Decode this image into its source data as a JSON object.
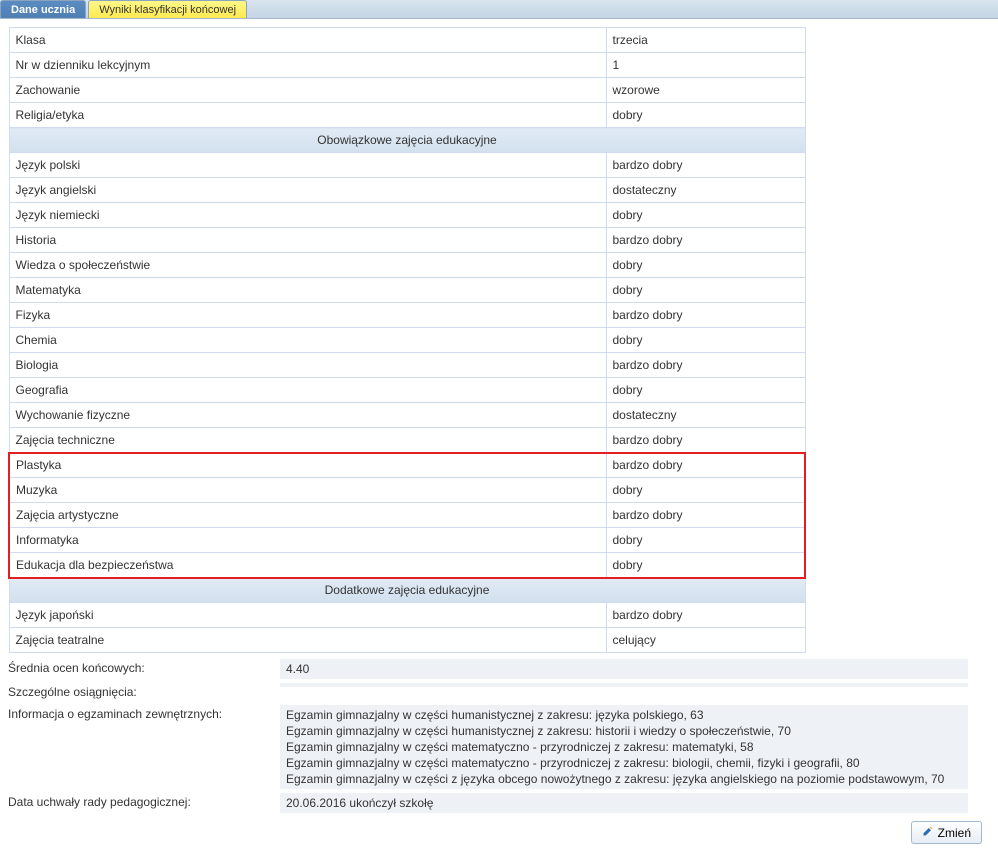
{
  "tabs": [
    {
      "label": "Dane ucznia",
      "active": true
    },
    {
      "label": "Wyniki klasyfikacji końcowej",
      "active": false
    }
  ],
  "basic_info": [
    {
      "label": "Klasa",
      "value": "trzecia"
    },
    {
      "label": "Nr w dzienniku lekcyjnym",
      "value": "1"
    },
    {
      "label": "Zachowanie",
      "value": "wzorowe"
    },
    {
      "label": "Religia/etyka",
      "value": "dobry"
    }
  ],
  "section1_header": "Obowiązkowe zajęcia edukacyjne",
  "section1_rows": [
    {
      "label": "Język polski",
      "value": "bardzo dobry"
    },
    {
      "label": "Język angielski",
      "value": "dostateczny"
    },
    {
      "label": "Język niemiecki",
      "value": "dobry"
    },
    {
      "label": "Historia",
      "value": "bardzo dobry"
    },
    {
      "label": "Wiedza o społeczeństwie",
      "value": "dobry"
    },
    {
      "label": "Matematyka",
      "value": "dobry"
    },
    {
      "label": "Fizyka",
      "value": "bardzo dobry"
    },
    {
      "label": "Chemia",
      "value": "dobry"
    },
    {
      "label": "Biologia",
      "value": "bardzo dobry"
    },
    {
      "label": "Geografia",
      "value": "dobry"
    },
    {
      "label": "Wychowanie fizyczne",
      "value": "dostateczny"
    },
    {
      "label": "Zajęcia techniczne",
      "value": "bardzo dobry"
    }
  ],
  "highlighted_rows": [
    {
      "label": "Plastyka",
      "value": "bardzo dobry"
    },
    {
      "label": "Muzyka",
      "value": "dobry"
    },
    {
      "label": "Zajęcia artystyczne",
      "value": "bardzo dobry"
    },
    {
      "label": "Informatyka",
      "value": "dobry"
    },
    {
      "label": "Edukacja dla bezpieczeństwa",
      "value": "dobry"
    }
  ],
  "section2_header": "Dodatkowe zajęcia edukacyjne",
  "section2_rows": [
    {
      "label": "Język japoński",
      "value": "bardzo dobry"
    },
    {
      "label": "Zajęcia teatralne",
      "value": "celujący"
    }
  ],
  "summary": {
    "avg_label": "Średnia ocen końcowych:",
    "avg_value": "4.40",
    "achievements_label": "Szczególne osiągnięcia:",
    "achievements_value": "",
    "exams_label": "Informacja o egzaminach zewnętrznych:",
    "exams_value": "Egzamin gimnazjalny w części humanistycznej z zakresu: języka polskiego, 63\nEgzamin gimnazjalny w części humanistycznej z zakresu: historii i wiedzy o społeczeństwie, 70\nEgzamin gimnazjalny w części matematyczno - przyrodniczej z zakresu: matematyki, 58\nEgzamin gimnazjalny w części matematyczno - przyrodniczej z zakresu: biologii, chemii, fizyki i geografii, 80\nEgzamin gimnazjalny w części z języka obcego nowożytnego z zakresu: języka angielskiego na poziomie podstawowym, 70",
    "council_date_label": "Data uchwały rady pedagogicznej:",
    "council_date_value": "20.06.2016 ukończył szkołę"
  },
  "buttons": {
    "change": "Zmień"
  }
}
